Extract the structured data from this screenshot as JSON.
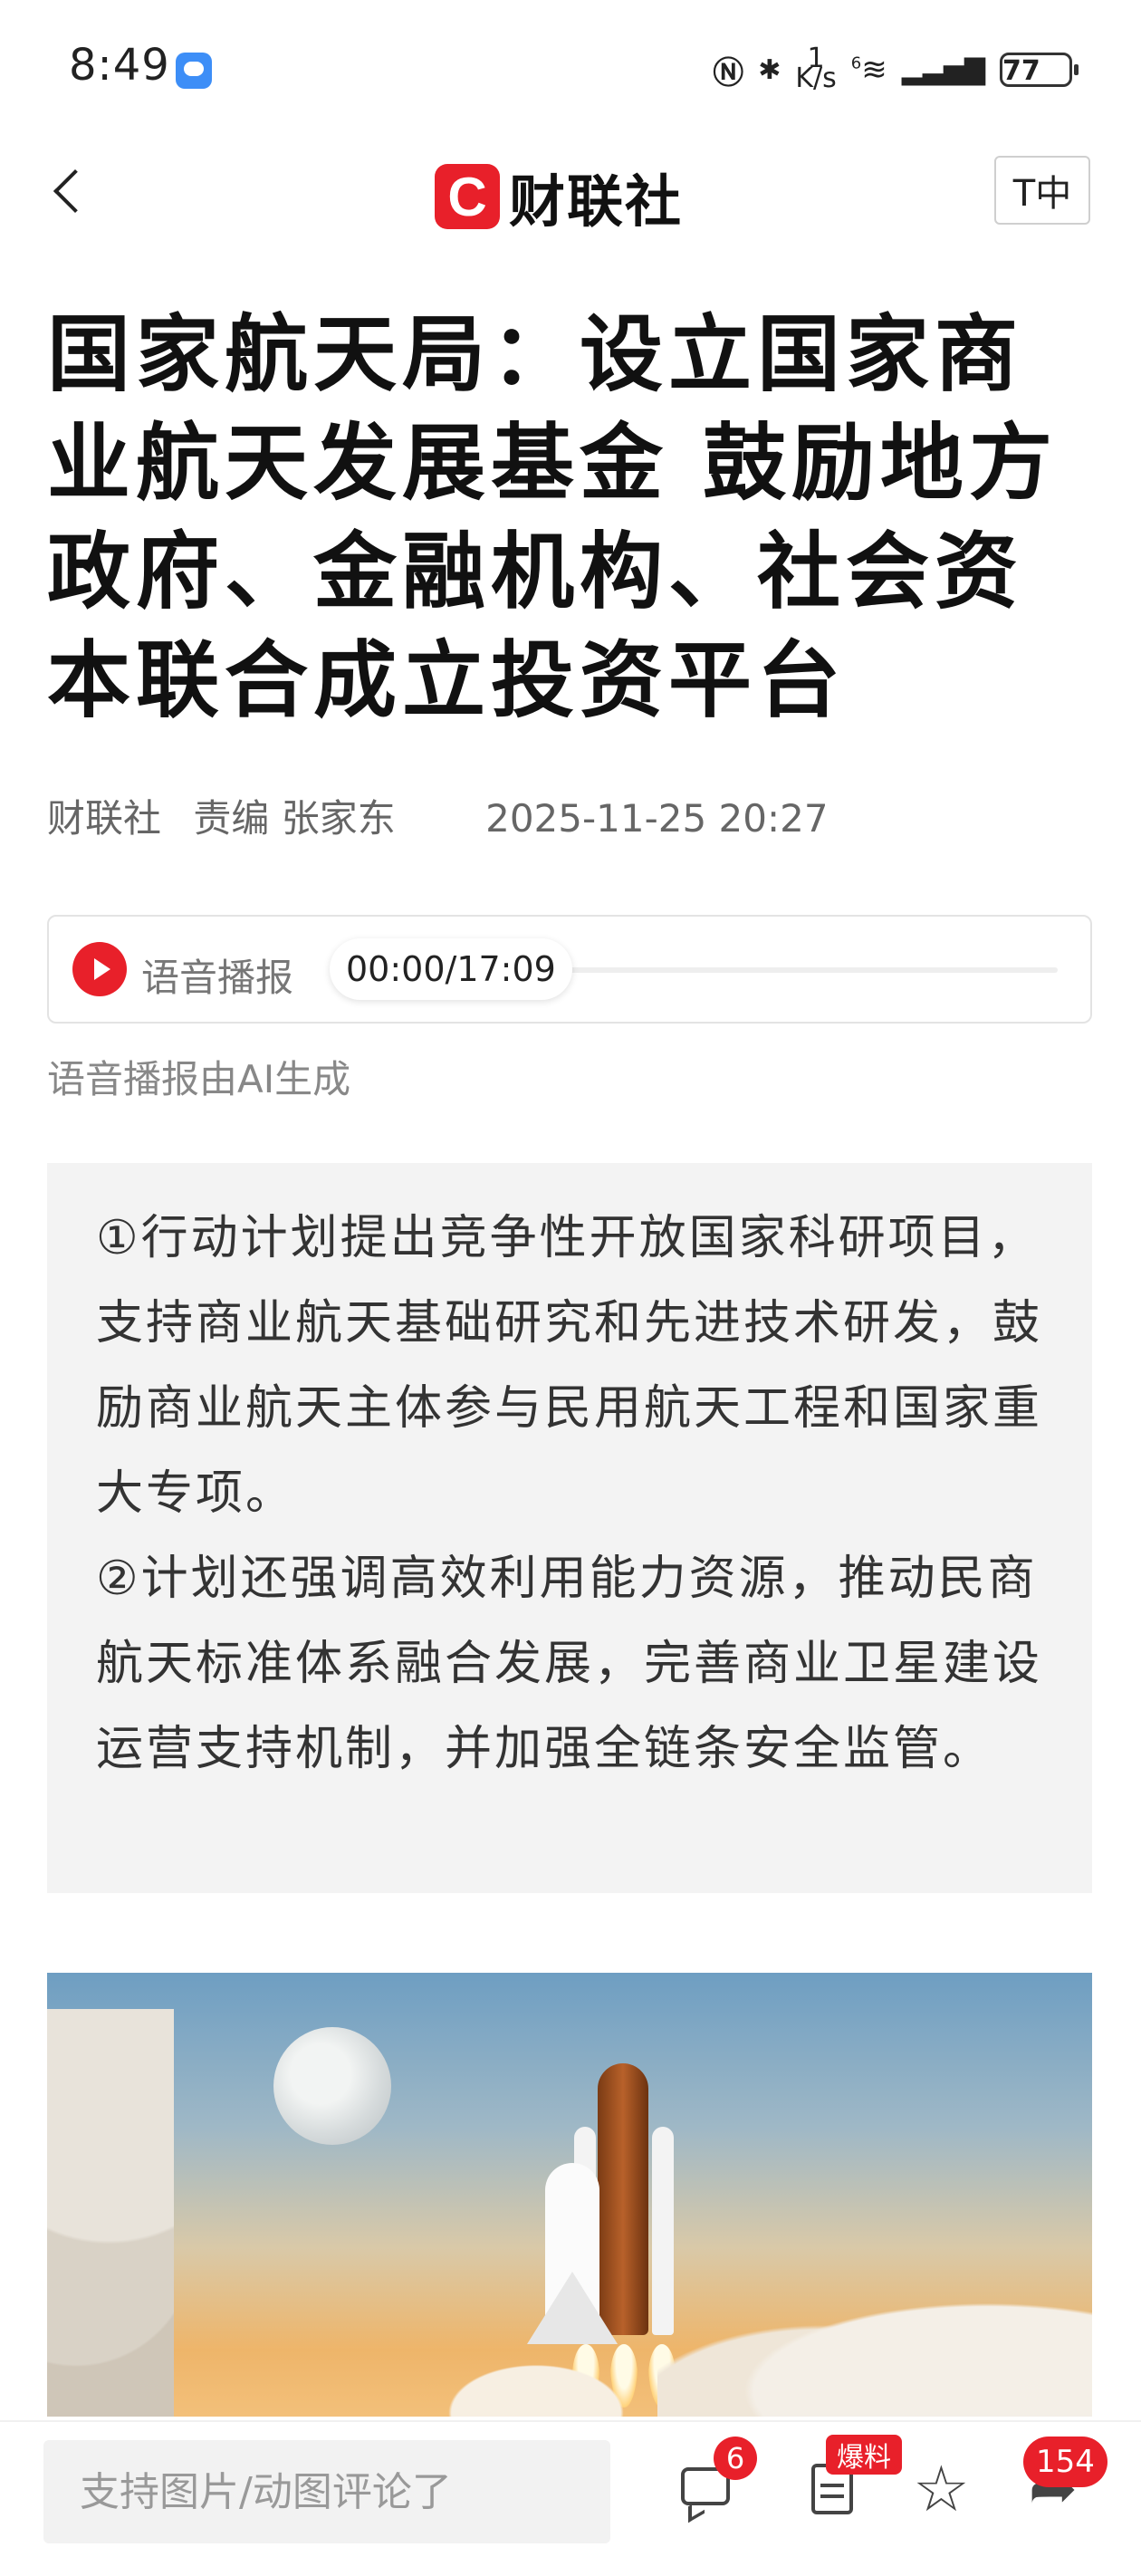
{
  "status_bar": {
    "time": "8:49",
    "net_speed_top": "1",
    "net_speed_bottom": "K/s",
    "network": "6",
    "battery": "77"
  },
  "header": {
    "logo_mark": "C",
    "logo_text": "财联社",
    "font_toggle": "T中"
  },
  "article": {
    "title": "国家航天局：设立国家商业航天发展基金 鼓励地方政府、金融机构、社会资本联合成立投资平台",
    "source": "财联社",
    "editor": "责编 张家东",
    "date": "2025-11-25 20:27"
  },
  "audio": {
    "label": "语音播报",
    "time": "00:00/17:09",
    "note": "语音播报由AI生成"
  },
  "summary": {
    "points": [
      "①行动计划提出竞争性开放国家科研项目，支持商业航天基础研究和先进技术研发，鼓励商业航天主体参与民用航天工程和国家重大专项。",
      "②计划还强调高效利用能力资源，推动民商航天标准体系融合发展，完善商业卫星建设运营支持机制，并加强全链条安全监管。"
    ]
  },
  "bottom_bar": {
    "comment_placeholder": "支持图片/动图评论了",
    "comment_count": "6",
    "report_badge": "爆料",
    "share_count": "154"
  },
  "icons": {
    "back": "back-icon",
    "play": "play-icon",
    "comment": "comment-icon",
    "report": "report-icon",
    "star": "star-icon",
    "share": "share-icon"
  },
  "colors": {
    "brand_red": "#e8202a",
    "summary_bg": "#f3f3f3"
  }
}
